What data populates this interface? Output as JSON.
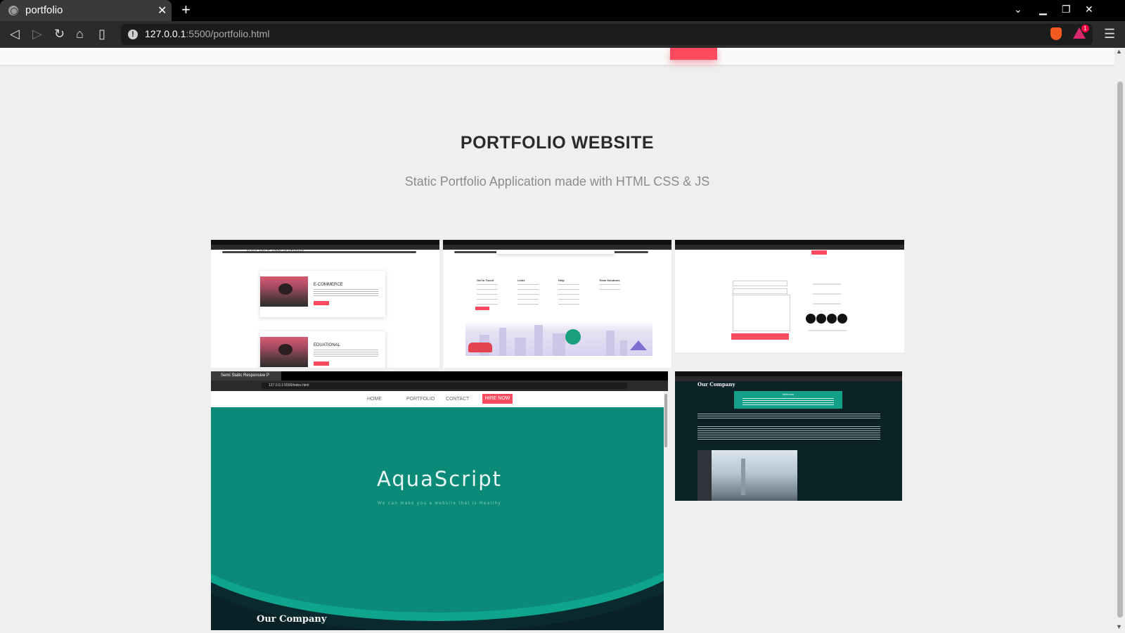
{
  "browser": {
    "tab_title": "portfolio",
    "tab_close": "✕",
    "new_tab": "+",
    "url_host": "127.0.0.1",
    "url_path": ":5500/portfolio.html",
    "rewards_badge": "1",
    "icons": [
      "globe-icon",
      "back-icon",
      "forward-icon",
      "reload-icon",
      "home-icon",
      "bookmark-icon",
      "info-icon",
      "brave-shield-icon",
      "brave-rewards-icon",
      "menu-icon",
      "chevron-down-icon",
      "minimize-icon",
      "maximize-icon",
      "close-icon"
    ]
  },
  "colors": {
    "accent": "#fc4a5f",
    "teal": "#0b8a78",
    "dark": "#0a2227",
    "page_bg": "#efefef"
  },
  "section": {
    "title": "PORTFOLIO WEBSITE",
    "subtitle": "Static Portfolio Application made with HTML CSS & JS"
  },
  "gallery": {
    "shot1": {
      "heading": "AVAILABLE APPLICATIONS",
      "cards": [
        {
          "title": "E-COMMERCE"
        },
        {
          "title": "EDUATIONAL"
        }
      ]
    },
    "shot2": {
      "columns": [
        {
          "title": "Get in Touch"
        },
        {
          "title": "Links"
        },
        {
          "title": "Help"
        },
        {
          "title": "Team Solutions"
        }
      ]
    },
    "shot4": {
      "tab_title": "Semi Static Responsive P",
      "url": "127.0.0.1:5500/index.html",
      "nav": {
        "home": "HOME",
        "portfolio": "PORTFOLIO",
        "contact": "CONTACT",
        "hire": "HIRE NOW"
      },
      "brand": "AquaScript",
      "tagline": "We can make you a website that is Healthy",
      "company": "Our Company"
    },
    "shot5": {
      "title": "Our Company",
      "welcome": "Welcome"
    }
  }
}
